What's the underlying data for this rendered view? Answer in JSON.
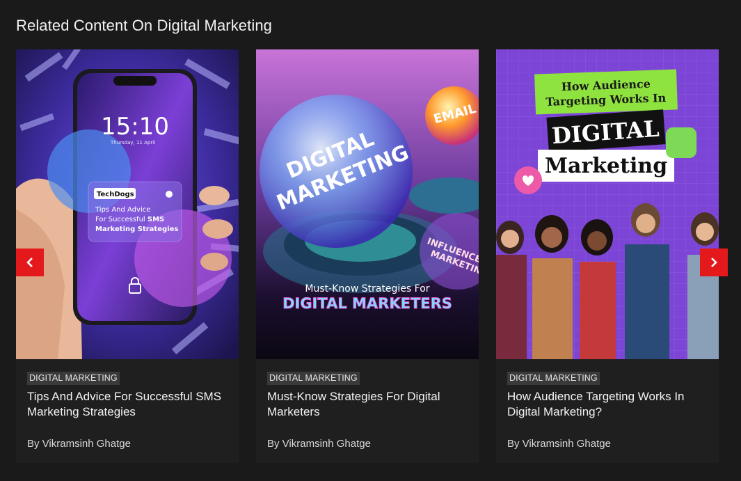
{
  "section": {
    "title": "Related Content On Digital Marketing"
  },
  "cards": [
    {
      "tag": "DIGITAL MARKETING",
      "title": "Tips And Advice For Successful SMS Marketing Strategies",
      "author": "By Vikramsinh Ghatge",
      "thumb": {
        "time": "15:10",
        "date": "Thursday, 11 April",
        "brand": "TechDogs",
        "line1": "Tips And Advice",
        "line2": "For Successful ",
        "line2_bold": "SMS",
        "line3": "Marketing Strategies"
      }
    },
    {
      "tag": "DIGITAL MARKETING",
      "title": "Must-Know Strategies For Digital Marketers",
      "author": "By Vikramsinh Ghatge",
      "thumb": {
        "orb_line1": "DIGITAL",
        "orb_line2": "MARKETING",
        "email": "EMAIL",
        "influence1": "INFLUENCE",
        "influence2": "MARKETING",
        "caption": "Must-Know Strategies For",
        "caption_big": "DIGITAL MARKETERS"
      }
    },
    {
      "tag": "DIGITAL MARKETING",
      "title": "How Audience Targeting Works In Digital Marketing?",
      "author": "By Vikramsinh Ghatge",
      "thumb": {
        "banner1": "How Audience",
        "banner2": "Targeting Works In",
        "word1": "DIGITAL",
        "word2": "Marketing"
      }
    }
  ],
  "controls": {
    "prev_icon": "chevron-left-icon",
    "next_icon": "chevron-right-icon",
    "accent": "#e3191c"
  }
}
